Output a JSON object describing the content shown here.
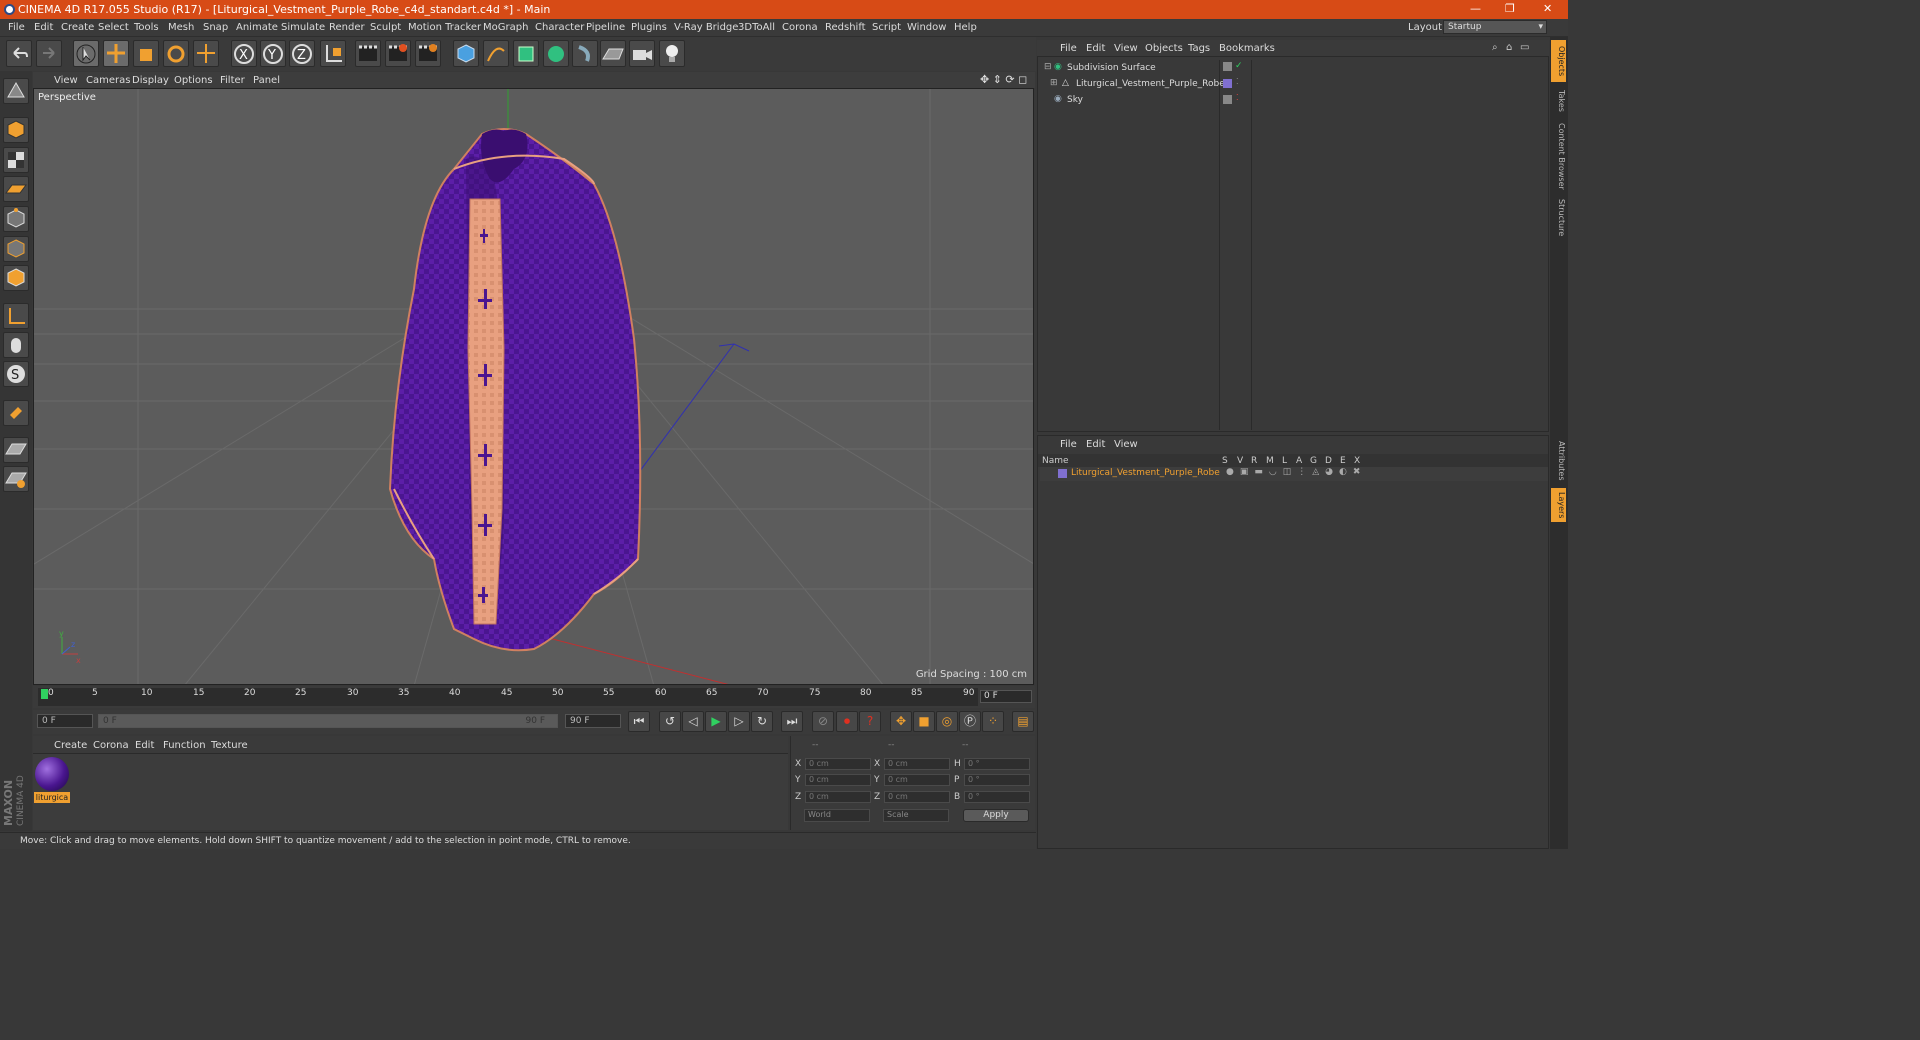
{
  "window": {
    "title": "CINEMA 4D R17.055 Studio (R17) - [Liturgical_Vestment_Purple_Robe_c4d_standart.c4d *] - Main"
  },
  "menubar": {
    "items": [
      "File",
      "Edit",
      "Create",
      "Select",
      "Tools",
      "Mesh",
      "Snap",
      "Animate",
      "Simulate",
      "Render",
      "Sculpt",
      "Motion Tracker",
      "MoGraph",
      "Character",
      "Pipeline",
      "Plugins",
      "V-Ray Bridge",
      "3DToAll",
      "Corona",
      "Redshift",
      "Script",
      "Window",
      "Help"
    ],
    "layout_label": "Layout:",
    "layout_value": "Startup"
  },
  "viewport": {
    "menu": [
      "View",
      "Cameras",
      "Display",
      "Options",
      "Filter",
      "Panel"
    ],
    "label": "Perspective",
    "grid_spacing": "Grid Spacing : 100 cm"
  },
  "timeline": {
    "ticks": [
      "0",
      "5",
      "10",
      "15",
      "20",
      "25",
      "30",
      "35",
      "40",
      "45",
      "50",
      "55",
      "60",
      "65",
      "70",
      "75",
      "80",
      "85",
      "90"
    ],
    "frame_end": "0 F",
    "current_frame": "0 F",
    "range_start": "0 F",
    "range_end": "90 F",
    "range_end_field": "90 F"
  },
  "material_manager": {
    "menu": [
      "Create",
      "Corona",
      "Edit",
      "Function",
      "Texture"
    ],
    "material_name": "liturgica"
  },
  "coordinates": {
    "header": [
      "--",
      "--",
      "--"
    ],
    "rows": [
      {
        "a": "X",
        "av": "0 cm",
        "b": "X",
        "bv": "0 cm",
        "c": "H",
        "cv": "0 °"
      },
      {
        "a": "Y",
        "av": "0 cm",
        "b": "Y",
        "bv": "0 cm",
        "c": "P",
        "cv": "0 °"
      },
      {
        "a": "Z",
        "av": "0 cm",
        "b": "Z",
        "bv": "0 cm",
        "c": "B",
        "cv": "0 °"
      }
    ],
    "world": "World",
    "scale": "Scale",
    "apply": "Apply"
  },
  "status": {
    "text": "Move: Click and drag to move elements. Hold down SHIFT to quantize movement / add to the selection in point mode, CTRL to remove."
  },
  "object_manager": {
    "menu": [
      "File",
      "Edit",
      "View",
      "Objects",
      "Tags",
      "Bookmarks"
    ],
    "objects": [
      {
        "name": "Subdivision Surface"
      },
      {
        "name": "Liturgical_Vestment_Purple_Robe"
      },
      {
        "name": "Sky"
      }
    ]
  },
  "layer_manager": {
    "menu": [
      "File",
      "Edit",
      "View"
    ],
    "columns": [
      "Name",
      "S",
      "V",
      "R",
      "M",
      "L",
      "A",
      "G",
      "D",
      "E",
      "X"
    ],
    "layers": [
      {
        "name": "Liturgical_Vestment_Purple_Robe"
      }
    ]
  },
  "side_tabs": [
    "Objects",
    "Takes",
    "Content Browser",
    "Structure",
    "Attributes",
    "Layers"
  ],
  "brand": {
    "line1": "MAXON",
    "line2": "CINEMA 4D"
  },
  "colors": {
    "accent": "#d74b16",
    "robe": "#5a1aa0",
    "stole": "#e8a080",
    "layer_name": "#f0a030"
  }
}
